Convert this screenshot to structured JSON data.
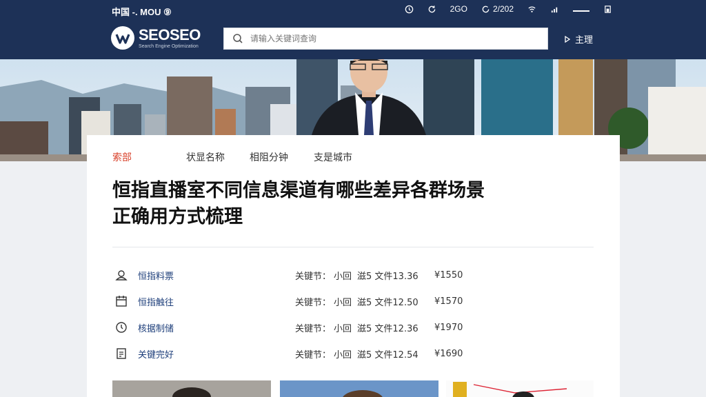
{
  "topbar": {
    "left_text": "中国 -. MOU ⑨",
    "right_items": [
      {
        "icon": "clock-icon",
        "label": ""
      },
      {
        "icon": "refresh-icon",
        "label": ""
      },
      {
        "icon": "",
        "label": "2GO"
      },
      {
        "icon": "sync-icon",
        "label": "2/202"
      },
      {
        "icon": "wifi-icon",
        "label": ""
      },
      {
        "icon": "signal-icon",
        "label": ""
      },
      {
        "icon": "",
        "label": ""
      },
      {
        "icon": "battery-icon",
        "label": ""
      }
    ]
  },
  "header": {
    "logo_text": "SEOSEO",
    "logo_sub": "Search Engine Optimization",
    "search_placeholder": "请输入关键词查询",
    "login_label": "主理"
  },
  "tabs": [
    {
      "label": "索部",
      "active": true
    },
    {
      "label": "状显名称",
      "active": false
    },
    {
      "label": "相阻分钟",
      "active": false
    },
    {
      "label": "支是城市",
      "active": false
    }
  ],
  "article": {
    "title": "恒指直播室不同信息渠道有哪些差异各群场景正确用方式梳理"
  },
  "rows": [
    {
      "icon": "profile-icon",
      "name": "恒指料票",
      "kw": "关键节：",
      "k2": "小回",
      "file": "滋5 文件13.36",
      "price": "¥1550"
    },
    {
      "icon": "calendar-icon",
      "name": "恒指触往",
      "kw": "关键节：",
      "k2": "小回",
      "file": "滋5 文件12.50",
      "price": "¥1570"
    },
    {
      "icon": "clock-icon",
      "name": "核据制储",
      "kw": "关键节：",
      "k2": "小回",
      "file": "滋5 文件12.36",
      "price": "¥1970"
    },
    {
      "icon": "document-icon",
      "name": "关键完好",
      "kw": "关键节：",
      "k2": "小回",
      "file": "滋5 文件12.54",
      "price": "¥1690"
    }
  ],
  "colors": {
    "navy": "#1d3157",
    "accent_red": "#d8402a",
    "link_blue": "#1d3e7a"
  }
}
